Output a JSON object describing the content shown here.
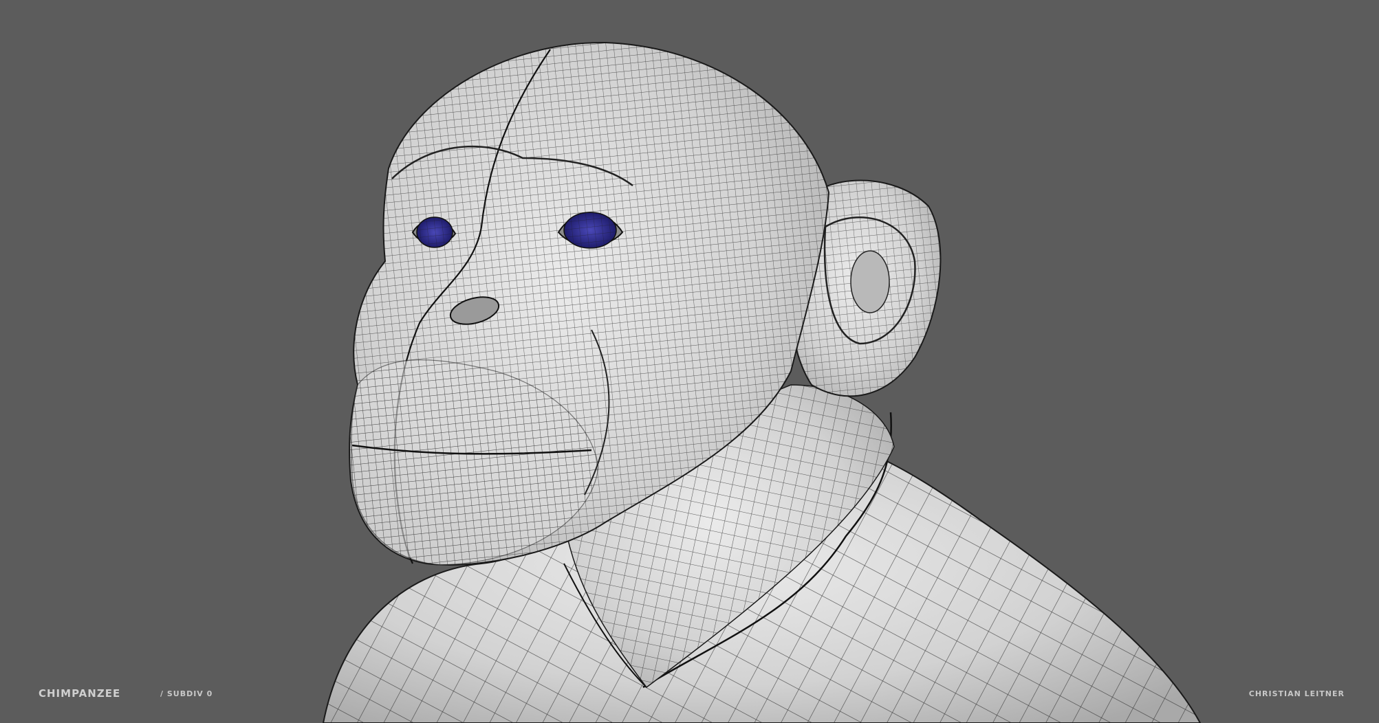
{
  "caption": {
    "title": "CHIMPANZEE",
    "subtitle": "/ SUBDIV 0",
    "author": "CHRISTIAN LEITNER"
  },
  "colors": {
    "background": "#5c5c5c",
    "mesh_surface": "#d9d9d9",
    "wire_lines": "#1a1a1a",
    "eye": "#2c2a8a"
  },
  "icons": {
    "model": "chimpanzee-wireframe-bust"
  }
}
